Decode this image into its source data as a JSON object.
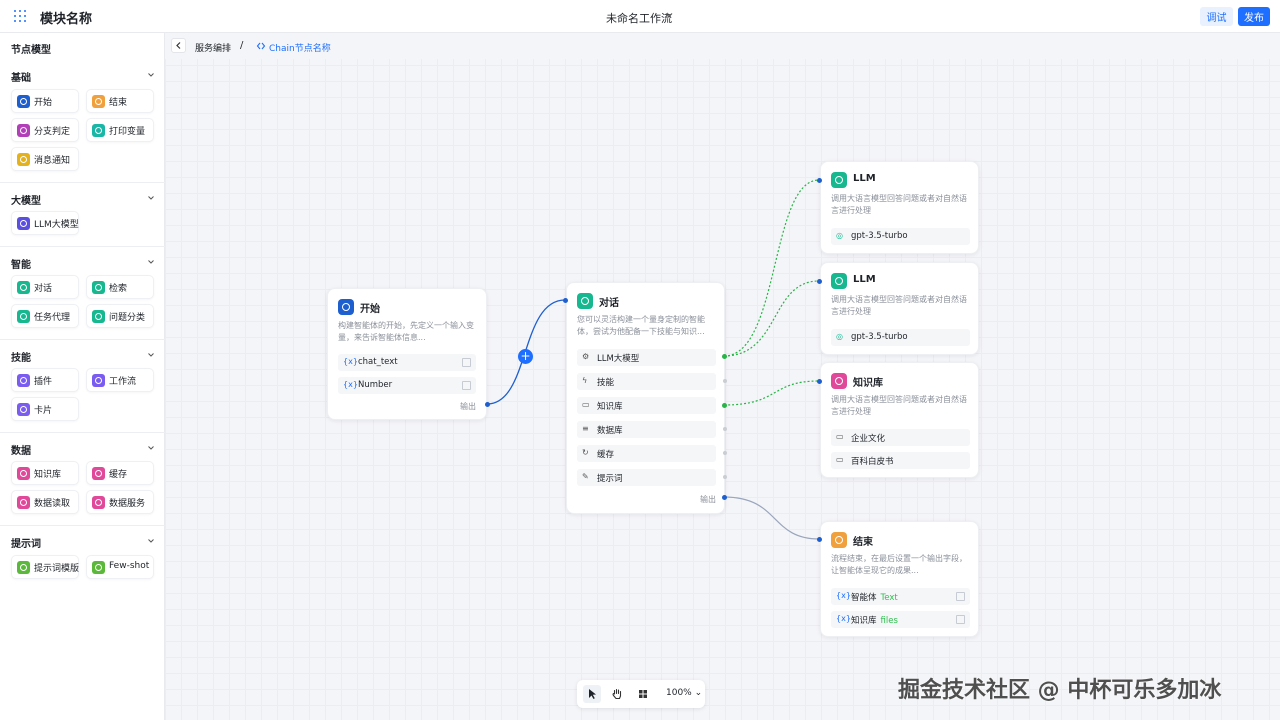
{
  "topbar": {
    "module_title": "模块名称",
    "workflow_name": "未命名工作流",
    "debug_label": "调试",
    "publish_label": "发布"
  },
  "sidebar": {
    "title": "节点模型",
    "sections": [
      {
        "title": "基础",
        "items": [
          "开始",
          "结束",
          "分支判定",
          "打印变量",
          "消息通知"
        ]
      },
      {
        "title": "大模型",
        "items": [
          "LLM大模型"
        ]
      },
      {
        "title": "智能",
        "items": [
          "对话",
          "检索",
          "任务代理",
          "问题分类"
        ]
      },
      {
        "title": "技能",
        "items": [
          "插件",
          "工作流",
          "卡片"
        ]
      },
      {
        "title": "数据",
        "items": [
          "知识库",
          "缓存",
          "数据读取",
          "数据服务"
        ]
      },
      {
        "title": "提示词",
        "items": [
          "提示词模版",
          "Few-shot"
        ]
      }
    ]
  },
  "breadcrumb": {
    "parent": "服务编排",
    "separator": "/",
    "current": "Chain节点名称"
  },
  "nodes": {
    "start": {
      "title": "开始",
      "desc": "构建智能体的开始，先定义一个输入变量，来告诉智能体信息...",
      "rows": [
        "chat_text",
        "Number"
      ],
      "output": "输出"
    },
    "dialog": {
      "title": "对话",
      "desc": "您可以灵活构建一个量身定制的智能体，尝试为他配备一下技能与知识...",
      "rows": [
        "LLM大模型",
        "技能",
        "知识库",
        "数据库",
        "缓存",
        "提示词"
      ],
      "output": "输出"
    },
    "llm1": {
      "title": "LLM",
      "desc": "调用大语言模型回答问题或者对自然语言进行处理",
      "model": "gpt-3.5-turbo"
    },
    "llm2": {
      "title": "LLM",
      "desc": "调用大语言模型回答问题或者对自然语言进行处理",
      "model": "gpt-3.5-turbo"
    },
    "kb": {
      "title": "知识库",
      "desc": "调用大语言模型回答问题或者对自然语言进行处理",
      "rows": [
        "企业文化",
        "百科白皮书"
      ]
    },
    "end": {
      "title": "结束",
      "desc": "流程结束，在最后设置一个输出字段，让智能体呈现它的成果...",
      "rows": [
        {
          "name": "智能体",
          "type": "Text"
        },
        {
          "name": "知识库",
          "type": "files"
        }
      ]
    }
  },
  "toolbar": {
    "zoom": "100%"
  },
  "watermark": "掘金技术社区 @ 中杯可乐多加冰",
  "colors": {
    "accent": "#1e6fff",
    "start": "#1e5fd0",
    "end": "#f0a03c",
    "dialog": "#17b890",
    "knowledge": "#e0489a",
    "edge_green": "#28b446"
  }
}
